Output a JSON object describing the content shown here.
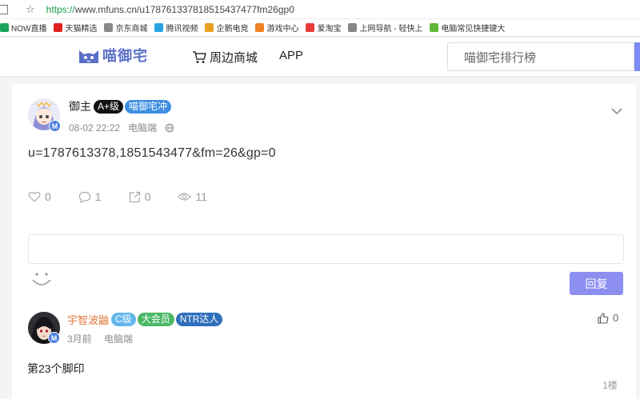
{
  "browser": {
    "url_proto": "https://",
    "url_rest": "www.mfuns.cn/u178761337818515437477fm26gp0",
    "bookmarks": [
      {
        "label": "NOW直播",
        "color": "#1aa55a"
      },
      {
        "label": "天猫精选",
        "color": "#e02020"
      },
      {
        "label": "京东商城",
        "color": "#888888"
      },
      {
        "label": "腾讯视频",
        "color": "#29a3e0"
      },
      {
        "label": "企鹅电竞",
        "color": "#e8a020"
      },
      {
        "label": "游戏中心",
        "color": "#f08020"
      },
      {
        "label": "爱淘宝",
        "color": "#e83a3a"
      },
      {
        "label": "上网导航 - 轻快上",
        "color": "#888888"
      },
      {
        "label": "电脑常见快捷键大",
        "color": "#5fb83a"
      }
    ]
  },
  "header": {
    "logo_text": "喵御宅",
    "nav_mall": "周边商城",
    "nav_app": "APP",
    "search_placeholder": "喵御宅排行榜"
  },
  "post": {
    "author": "御主",
    "level_tag": "A+级",
    "badge_tag": "喵御宅冲",
    "avatar_badge": "M",
    "time": "08-02 22:22",
    "device": "电脑端",
    "content": "u=1787613378,1851543477&fm=26&gp=0",
    "likes": "0",
    "comments": "1",
    "shares": "0",
    "views": "11"
  },
  "reply": {
    "button_label": "回复",
    "placeholder": ""
  },
  "comment": {
    "author": "宇智波鼬",
    "level_tag": "C级",
    "member_tag": "大会员",
    "title_tag": "NTR达人",
    "avatar_badge": "M",
    "time": "3月前",
    "device": "电脑端",
    "likes": "0",
    "content": "第23个脚印",
    "floor": "1楼"
  }
}
